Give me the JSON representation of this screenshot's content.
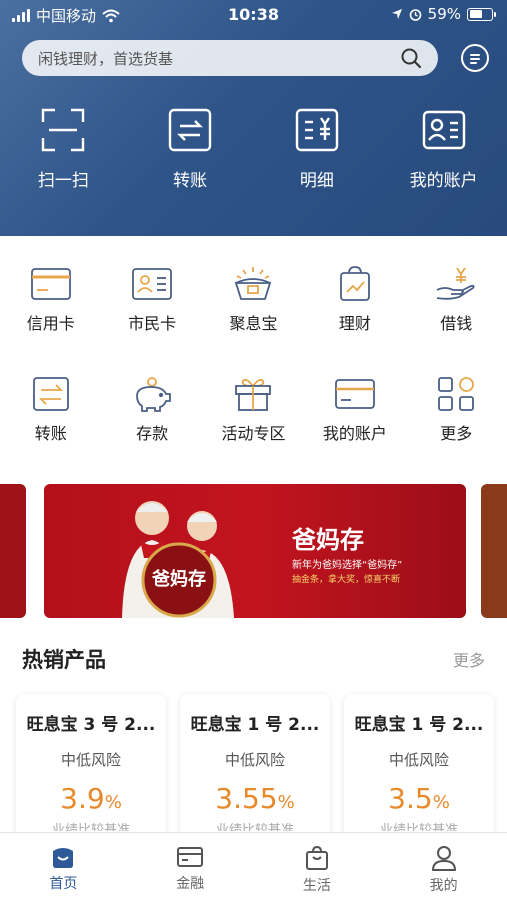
{
  "status_bar": {
    "carrier": "中国移动",
    "time": "10:38",
    "battery": "59%",
    "battery_level": 0.59
  },
  "search": {
    "placeholder": "闲钱理财，首选货基"
  },
  "header_actions": [
    {
      "label": "扫一扫",
      "icon": "scan-icon"
    },
    {
      "label": "转账",
      "icon": "transfer-icon"
    },
    {
      "label": "明细",
      "icon": "statement-icon"
    },
    {
      "label": "我的账户",
      "icon": "account-icon"
    }
  ],
  "services": [
    {
      "label": "信用卡",
      "icon": "credit-card-icon"
    },
    {
      "label": "市民卡",
      "icon": "citizen-card-icon"
    },
    {
      "label": "聚息宝",
      "icon": "basket-icon"
    },
    {
      "label": "理财",
      "icon": "chart-bag-icon"
    },
    {
      "label": "借钱",
      "icon": "loan-hand-icon"
    },
    {
      "label": "转账",
      "icon": "transfer-icon"
    },
    {
      "label": "存款",
      "icon": "piggy-bank-icon"
    },
    {
      "label": "活动专区",
      "icon": "gift-icon"
    },
    {
      "label": "我的账户",
      "icon": "card-icon"
    },
    {
      "label": "更多",
      "icon": "more-grid-icon"
    }
  ],
  "banner": {
    "title": "爸妈存",
    "subtitle": "新年为爸妈选择“爸妈存”",
    "tagline": "抽金条，拿大奖，惊喜不断",
    "bag_text": "爸妈存"
  },
  "hot_products": {
    "title": "热销产品",
    "more": "更多",
    "items": [
      {
        "name": "旺息宝 3 号 2...",
        "risk": "中低风险",
        "rate": "3.9",
        "unit": "%",
        "desc": "业绩比较基准"
      },
      {
        "name": "旺息宝 1 号 2...",
        "risk": "中低风险",
        "rate": "3.55",
        "unit": "%",
        "desc": "业绩比较基准"
      },
      {
        "name": "旺息宝 1 号 2...",
        "risk": "中低风险",
        "rate": "3.5",
        "unit": "%",
        "desc": "业绩比较基准"
      }
    ]
  },
  "tabs": [
    {
      "label": "首页",
      "icon": "home-icon",
      "active": true
    },
    {
      "label": "金融",
      "icon": "finance-card-icon",
      "active": false
    },
    {
      "label": "生活",
      "icon": "shopping-bag-icon",
      "active": false
    },
    {
      "label": "我的",
      "icon": "person-icon",
      "active": false
    }
  ],
  "colors": {
    "header": "#2e5488",
    "accent_orange": "#e8892b",
    "tab_active": "#2e5a9a",
    "banner_red": "#b3101c"
  }
}
